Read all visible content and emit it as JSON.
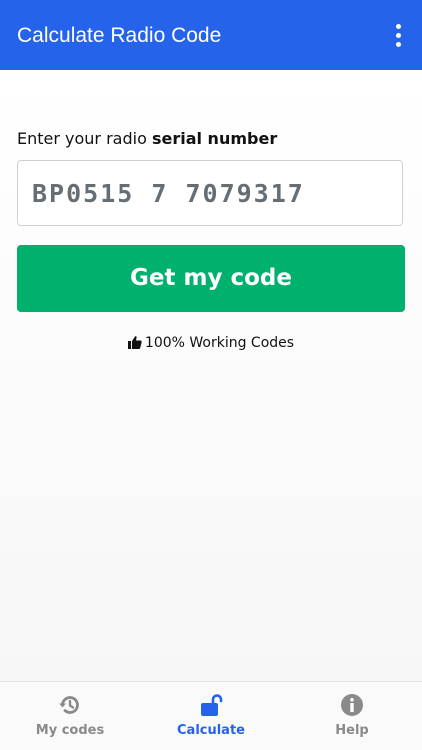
{
  "app_bar": {
    "title": "Calculate Radio Code",
    "menu_icon": "more-vert-icon",
    "color": "#2563ea"
  },
  "form": {
    "label_prefix": "Enter your radio ",
    "label_bold": "serial number",
    "serial_value": "BP0515 7 7079317"
  },
  "action": {
    "button_label": "Get my code",
    "button_color": "#00b16d"
  },
  "note": {
    "icon": "thumbs-up-icon",
    "text": "100% Working Codes"
  },
  "bottom_nav": {
    "items": [
      {
        "label": "My codes",
        "icon": "history-icon",
        "active": false
      },
      {
        "label": "Calculate",
        "icon": "unlock-icon",
        "active": true
      },
      {
        "label": "Help",
        "icon": "info-icon",
        "active": false
      }
    ],
    "active_color": "#2563ea",
    "inactive_color": "#8a8a8a"
  }
}
